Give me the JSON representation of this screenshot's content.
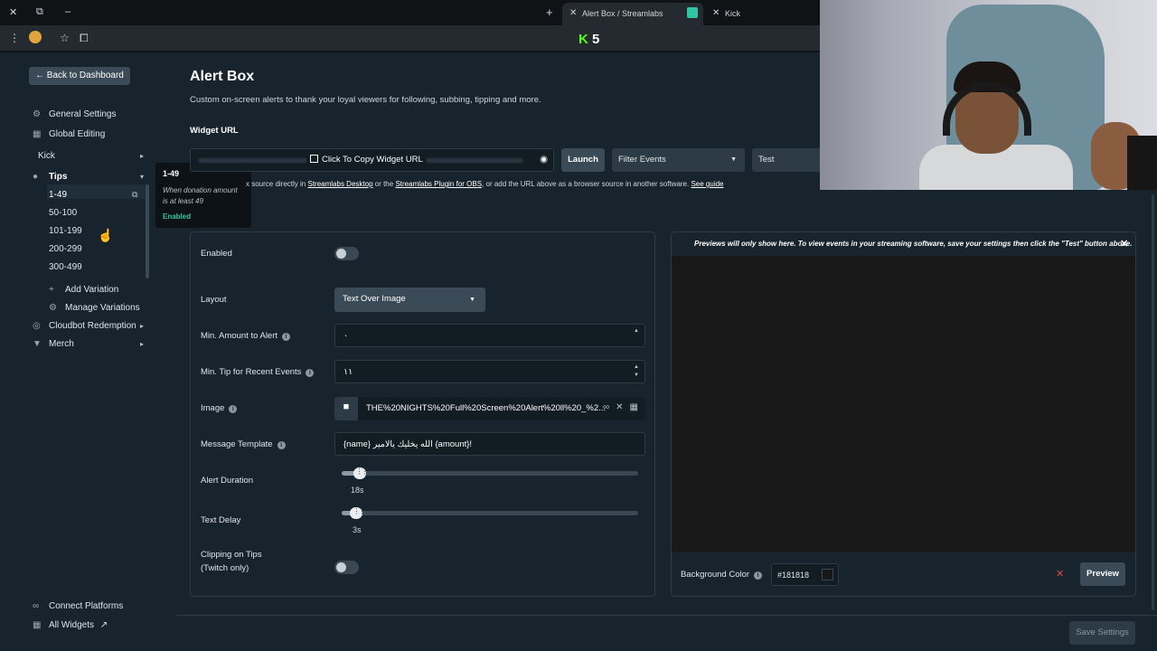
{
  "browser": {
    "tabs": [
      {
        "label": "Alert Box / Streamlabs",
        "active": true
      },
      {
        "label": "Kick",
        "active": false
      }
    ],
    "kick_badge": "5"
  },
  "sidebar": {
    "back_label": "Back to Dashboard",
    "items": [
      {
        "label": "General Settings",
        "icon": "gear-icon"
      },
      {
        "label": "Global Editing",
        "icon": "grid-icon"
      },
      {
        "label": "Kick"
      },
      {
        "label": "Tips",
        "icon": "coins-icon"
      }
    ],
    "variations": [
      "1-49",
      "50-100",
      "101-199",
      "200-299",
      "300-499"
    ],
    "add_variation": "Add Variation",
    "manage_variations": "Manage Variations",
    "cloudbot": "Cloudbot Redemption",
    "merch": "Merch",
    "connect_platforms": "Connect Platforms",
    "all_widgets": "All Widgets"
  },
  "tooltip": {
    "title": "1-49",
    "description": "When donation amount is at least 49",
    "status": "Enabled"
  },
  "main": {
    "title": "Alert Box",
    "description": "Custom on-screen alerts to thank your loyal viewers for following, subbing, tipping and more.",
    "widget_url_label": "Widget URL",
    "copy_url_label": "Click To Copy Widget URL",
    "launch_label": "Launch",
    "filter_events": "Filter Events",
    "test_label": "Test",
    "hint_prefix": "x source directly in",
    "hint_link1": "Streamlabs Desktop",
    "hint_mid": "or the",
    "hint_link2": "Streamlabs Plugin for OBS",
    "hint_suffix": ", or add the URL above as a browser source in another software.",
    "hint_link3": "See guide"
  },
  "settings": {
    "enabled_label": "Enabled",
    "layout_label": "Layout",
    "layout_value": "Text Over Image",
    "min_amount_label": "Min. Amount to Alert",
    "min_amount_value": "٠",
    "min_tip_label": "Min. Tip for Recent Events",
    "min_tip_value": "١١",
    "image_label": "Image",
    "image_value": "THE%20NIGHTS%20Full%20Screen%20Alert%20ll%20_%2...",
    "message_label": "Message Template",
    "message_value": "{name} الله يخليك يالامير {amount}!",
    "duration_label": "Alert Duration",
    "duration_value": "18s",
    "duration_fraction": 0.06,
    "delay_label": "Text Delay",
    "delay_value": "3s",
    "delay_fraction": 0.05,
    "clipping_label": "Clipping on Tips",
    "clipping_sub": "(Twitch only)"
  },
  "preview": {
    "note": "Previews will only show here. To view events in your streaming software, save your settings then click the \"Test\" button above.",
    "bgcolor_label": "Background Color",
    "bgcolor_value": "#181818",
    "preview_label": "Preview"
  },
  "footer": {
    "save_label": "Save Settings"
  }
}
